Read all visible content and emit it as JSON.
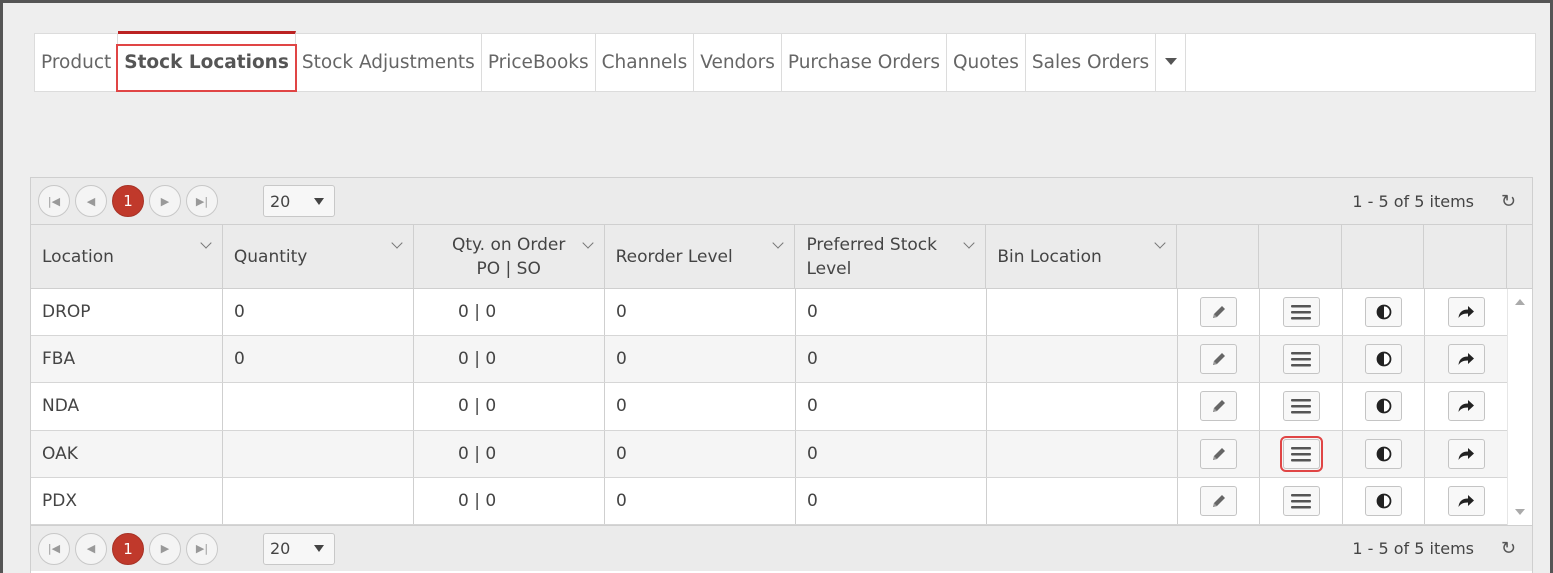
{
  "tabs": [
    {
      "label": "Product",
      "active": false
    },
    {
      "label": "Stock Locations",
      "active": true
    },
    {
      "label": "Stock Adjustments",
      "active": false
    },
    {
      "label": "PriceBooks",
      "active": false
    },
    {
      "label": "Channels",
      "active": false
    },
    {
      "label": "Vendors",
      "active": false
    },
    {
      "label": "Purchase Orders",
      "active": false
    },
    {
      "label": "Quotes",
      "active": false
    },
    {
      "label": "Sales Orders",
      "active": false
    }
  ],
  "pager": {
    "current_page": "1",
    "page_size": "20",
    "info": "1 - 5 of 5 items"
  },
  "columns": {
    "location": "Location",
    "quantity": "Quantity",
    "qty_on_order_line1": "Qty. on Order",
    "qty_on_order_line2": "PO | SO",
    "reorder_level": "Reorder Level",
    "preferred_line1": "Preferred Stock",
    "preferred_line2": "Level",
    "bin_location": "Bin Location"
  },
  "rows": [
    {
      "location": "DROP",
      "quantity": "0",
      "qty_on_order": "0 | 0",
      "reorder_level": "0",
      "preferred": "0",
      "bin": ""
    },
    {
      "location": "FBA",
      "quantity": "0",
      "qty_on_order": "0 | 0",
      "reorder_level": "0",
      "preferred": "0",
      "bin": ""
    },
    {
      "location": "NDA",
      "quantity": "",
      "qty_on_order": "0 | 0",
      "reorder_level": "0",
      "preferred": "0",
      "bin": ""
    },
    {
      "location": "OAK",
      "quantity": "",
      "qty_on_order": "0 | 0",
      "reorder_level": "0",
      "preferred": "0",
      "bin": ""
    },
    {
      "location": "PDX",
      "quantity": "",
      "qty_on_order": "0 | 0",
      "reorder_level": "0",
      "preferred": "0",
      "bin": ""
    }
  ],
  "row_actions": [
    "pencil-icon",
    "menu-icon",
    "contrast-icon",
    "share-icon"
  ],
  "colors": {
    "accent": "#c0392b",
    "highlight": "#e04545"
  }
}
